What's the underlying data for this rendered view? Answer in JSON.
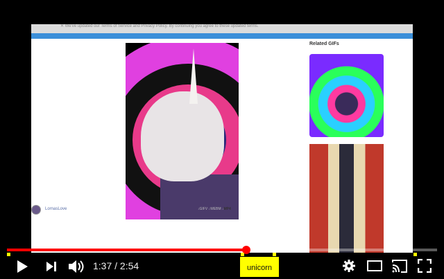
{
  "page": {
    "notice": "We've updated our Terms of Service and Privacy Policy. By continuing you agree to these updated terms.",
    "related_title": "Related GIFs",
    "username": "LornasLove",
    "formats": [
      "GIFV",
      "WEBM"
    ],
    "active_format": "MP4"
  },
  "player": {
    "current_time": "1:37",
    "duration": "2:54",
    "progress": 0.557,
    "chapter_label": "unicorn",
    "colors": {
      "progress": "#ff0000",
      "chapter": "#ffff00"
    }
  }
}
